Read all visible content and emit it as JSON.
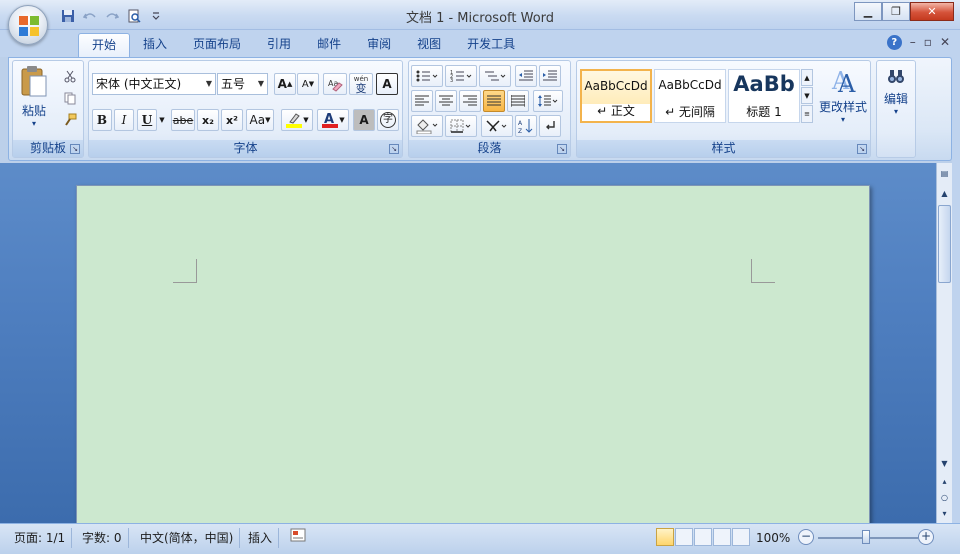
{
  "window": {
    "title": "文档 1 - Microsoft Word"
  },
  "quick_access": {
    "icons": [
      "save-icon",
      "undo-icon",
      "redo-icon",
      "print-preview-icon",
      "customize-icon"
    ]
  },
  "tabs": [
    {
      "label": "开始",
      "active": true
    },
    {
      "label": "插入"
    },
    {
      "label": "页面布局"
    },
    {
      "label": "引用"
    },
    {
      "label": "邮件"
    },
    {
      "label": "审阅"
    },
    {
      "label": "视图"
    },
    {
      "label": "开发工具"
    }
  ],
  "help": {
    "label": "?"
  },
  "clipboard": {
    "group_label": "剪贴板",
    "paste_label": "粘贴"
  },
  "font": {
    "group_label": "字体",
    "font_name": "宋体 (中文正文)",
    "font_size": "五号",
    "bold": "B",
    "italic": "I",
    "underline": "U",
    "strike": "abe",
    "subscript": "x₂",
    "superscript": "x²",
    "case": "Aa",
    "char_shading": "A",
    "enclose": "字",
    "grow": "A",
    "shrink": "A",
    "phonetic": "wén",
    "phonetic_char": "变"
  },
  "paragraph": {
    "group_label": "段落"
  },
  "styles": {
    "group_label": "样式",
    "items": [
      {
        "sample": "AaBbCcDd",
        "name": "↵ 正文",
        "selected": true
      },
      {
        "sample": "AaBbCcDd",
        "name": "↵ 无间隔"
      },
      {
        "sample": "AaBb",
        "name": "标题 1"
      }
    ],
    "change_label": "更改样式"
  },
  "editing": {
    "group_label": "编辑"
  },
  "status": {
    "page": "页面: 1/1",
    "words": "字数: 0",
    "language": "中文(简体，中国)",
    "mode": "插入",
    "zoom": "100%"
  },
  "colors": {
    "accent": "#15428b",
    "page_bg": "#cce8cf",
    "doc_bg": "#4f7fc0"
  }
}
